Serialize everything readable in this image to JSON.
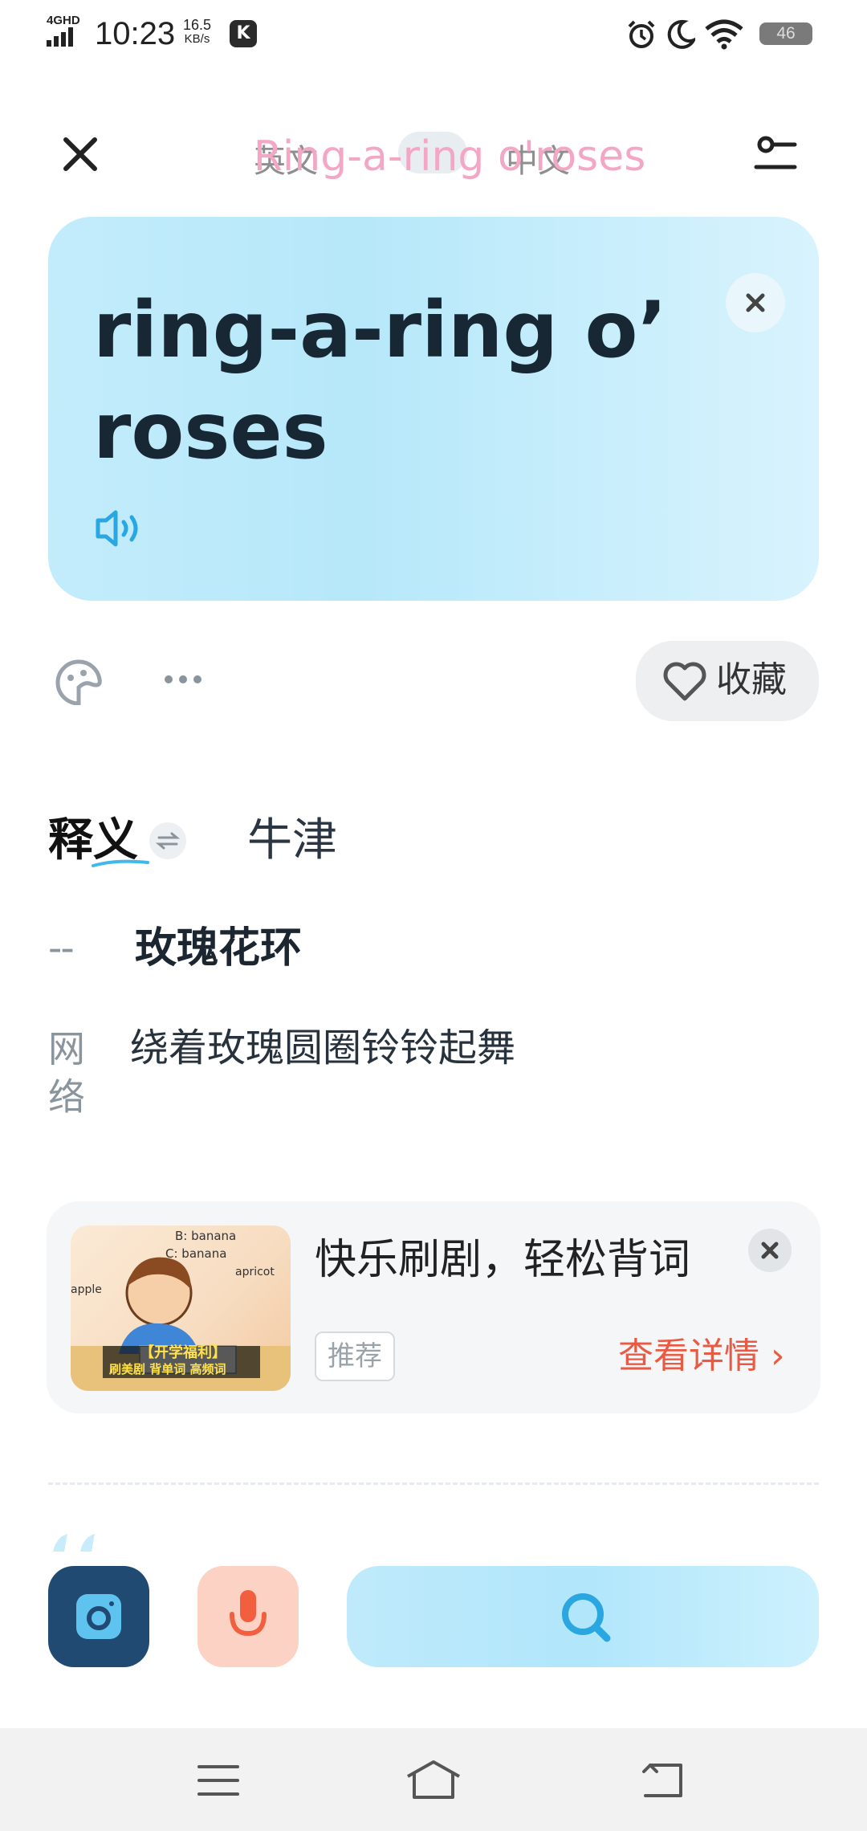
{
  "status_bar": {
    "network": "4GHD",
    "time": "10:23",
    "speed_value": "16.5",
    "speed_unit": "KB/s",
    "app_badge": "K",
    "battery": "46"
  },
  "header": {
    "title": "Ring-a-ring o'roses",
    "lang_from": "英文",
    "lang_to": "中文",
    "close_icon": "close-icon",
    "settings_icon": "settings-icon"
  },
  "word": {
    "text": "ring-a-ring o’ roses"
  },
  "actions": {
    "favorite_label": "收藏"
  },
  "tabs": {
    "definition": "释义",
    "oxford": "牛津"
  },
  "definitions": [
    {
      "pos": "--",
      "text": "玫瑰花环"
    },
    {
      "pos": "网络",
      "text": "绕着玫瑰圆圈铃铃起舞"
    }
  ],
  "ad": {
    "title": "快乐刷剧，轻松背词",
    "tag": "推荐",
    "link": "查看详情 ›",
    "image_words": [
      "B: banana",
      "C: banana",
      "apricot",
      "apple",
      "【开学福利】",
      "刷美剧 背单词 高频词"
    ]
  },
  "colors": {
    "accent_blue": "#2aa7e0",
    "card_bg": "#c3ecfb",
    "link_red": "#e95a44",
    "camera_bg": "#214a73",
    "mic_bg": "#fcd2c4"
  }
}
